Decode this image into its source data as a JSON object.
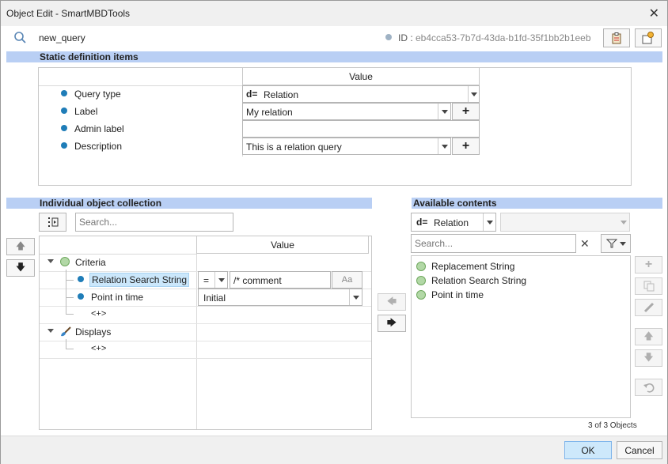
{
  "window": {
    "title": "Object Edit - SmartMBDTools"
  },
  "header": {
    "query_name": "new_query",
    "id_label": "ID :",
    "id_value": "eb4cca53-7b7d-43da-b1fd-35f1bb2b1eeb"
  },
  "static": {
    "title": "Static definition items",
    "value_header": "Value",
    "rows": [
      {
        "label": "Query type",
        "value": "Relation"
      },
      {
        "label": "Label",
        "value": "My relation"
      },
      {
        "label": "Admin label",
        "value": ""
      },
      {
        "label": "Description",
        "value": "This is a relation query"
      }
    ]
  },
  "collection": {
    "title": "Individual object collection",
    "search_placeholder": "Search...",
    "value_header": "Value",
    "criteria_label": "Criteria",
    "rss_label": "Relation Search String",
    "rss_op": "=",
    "rss_value": "/* comment",
    "rss_case": "Aa",
    "pit_label": "Point in time",
    "pit_value": "Initial",
    "add_1": "<+>",
    "displays_label": "Displays",
    "add_2": "<+>"
  },
  "available": {
    "title": "Available contents",
    "type_value": "Relation",
    "search_placeholder": "Search...",
    "items": [
      "Replacement String",
      "Relation Search String",
      "Point in time"
    ],
    "count": "3 of 3 Objects"
  },
  "footer": {
    "ok": "OK",
    "cancel": "Cancel"
  },
  "colors": {
    "accent": "#b9cff4",
    "ok_button": "#cde8fb",
    "dot": "#1f7db8"
  }
}
